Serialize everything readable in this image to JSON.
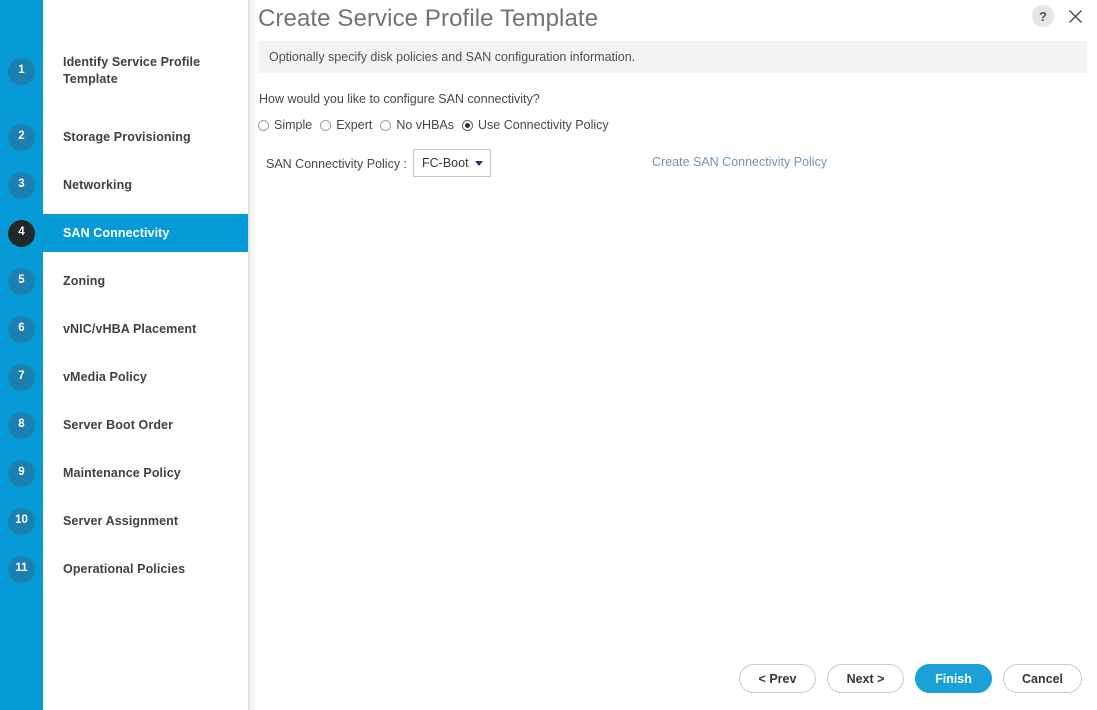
{
  "dialog": {
    "title": "Create Service Profile Template",
    "subtitle": "Optionally specify disk policies and SAN configuration information.",
    "help_label": "?",
    "close_label": "✕"
  },
  "sidebar": {
    "steps": [
      {
        "number": "1",
        "label": "Identify Service Profile Template",
        "active": false
      },
      {
        "number": "2",
        "label": "Storage Provisioning",
        "active": false
      },
      {
        "number": "3",
        "label": "Networking",
        "active": false
      },
      {
        "number": "4",
        "label": "SAN Connectivity",
        "active": true
      },
      {
        "number": "5",
        "label": "Zoning",
        "active": false
      },
      {
        "number": "6",
        "label": "vNIC/vHBA Placement",
        "active": false
      },
      {
        "number": "7",
        "label": "vMedia Policy",
        "active": false
      },
      {
        "number": "8",
        "label": "Server Boot Order",
        "active": false
      },
      {
        "number": "9",
        "label": "Maintenance Policy",
        "active": false
      },
      {
        "number": "10",
        "label": "Server Assignment",
        "active": false
      },
      {
        "number": "11",
        "label": "Operational Policies",
        "active": false
      }
    ]
  },
  "form": {
    "question": "How would you like to configure SAN connectivity?",
    "radio_options": [
      {
        "label": "Simple",
        "selected": false
      },
      {
        "label": "Expert",
        "selected": false
      },
      {
        "label": "No vHBAs",
        "selected": false
      },
      {
        "label": "Use Connectivity Policy",
        "selected": true
      }
    ],
    "policy_label": "SAN Connectivity Policy :",
    "policy_value": "FC-Boot",
    "policy_options": [
      "FC-Boot"
    ],
    "create_policy_link": "Create SAN Connectivity Policy"
  },
  "footer": {
    "buttons": [
      {
        "label": "< Prev",
        "primary": false
      },
      {
        "label": "Next >",
        "primary": false
      },
      {
        "label": "Finish",
        "primary": true
      },
      {
        "label": "Cancel",
        "primary": false
      }
    ]
  },
  "colors": {
    "accent_blue": "#069bd7",
    "primary_button": "#1ba0d7",
    "badge_inactive": "#1b7faf",
    "badge_active": "#23282c",
    "subtitle_bg": "#f4f3f2",
    "link": "#6e96b4"
  }
}
